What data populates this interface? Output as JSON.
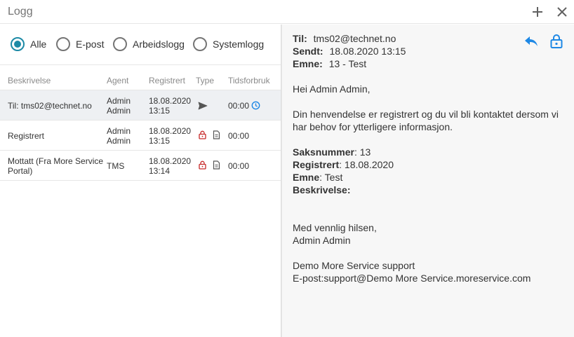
{
  "window": {
    "title": "Logg",
    "add_icon": "plus-icon",
    "close_icon": "close-icon"
  },
  "filters": {
    "selected": "Alle",
    "options": [
      "Alle",
      "E-post",
      "Arbeidslogg",
      "Systemlogg"
    ]
  },
  "table": {
    "headers": [
      "Beskrivelse",
      "Agent",
      "Registrert",
      "Type",
      "Tidsforbruk"
    ],
    "rows": [
      {
        "description": "Til: tms02@technet.no",
        "agent": "Admin Admin",
        "registered_date": "18.08.2020",
        "registered_time": "13:15",
        "type_icons": [
          "send-icon"
        ],
        "time_spent": "00:00",
        "time_icon": "clock-icon",
        "selected": true
      },
      {
        "description": "Registrert",
        "agent": "Admin Admin",
        "registered_date": "18.08.2020",
        "registered_time": "13:15",
        "type_icons": [
          "lock-icon",
          "document-icon"
        ],
        "time_spent": "00:00",
        "selected": false
      },
      {
        "description": "Mottatt (Fra More Service Portal)",
        "agent": "TMS",
        "registered_date": "18.08.2020",
        "registered_time": "13:14",
        "type_icons": [
          "lock-icon",
          "document-icon"
        ],
        "time_spent": "00:00",
        "selected": false
      }
    ]
  },
  "detail": {
    "to_label": "Til:",
    "to_value": "tms02@technet.no",
    "sent_label": "Sendt:",
    "sent_value": "18.08.2020 13:15",
    "subject_label": "Emne:",
    "subject_value": "13 - Test",
    "reply_icon": "reply-icon",
    "lock_icon": "unlock-icon",
    "greeting": "Hei Admin Admin,",
    "message": "Din henvendelse er registrert og du vil bli kontaktet dersom vi har behov for ytterligere informasjon.",
    "case_number_label": "Saksnummer",
    "case_number_value": ": 13",
    "registered_label": "Registrert",
    "registered_value": ": 18.08.2020",
    "subject2_label": "Emne",
    "subject2_value": ": Test",
    "description_label": "Beskrivelse",
    "description_value": ":",
    "closing": "Med vennlig hilsen,",
    "signature_name": "Admin Admin",
    "company": "Demo More Service support",
    "email_line": "E-post:support@Demo More Service.moreservice.com"
  },
  "colors": {
    "accent": "#1d8aa6",
    "icon_blue": "#1e88e5",
    "lock_red": "#c62828",
    "selected_row": "#eef0f3"
  }
}
